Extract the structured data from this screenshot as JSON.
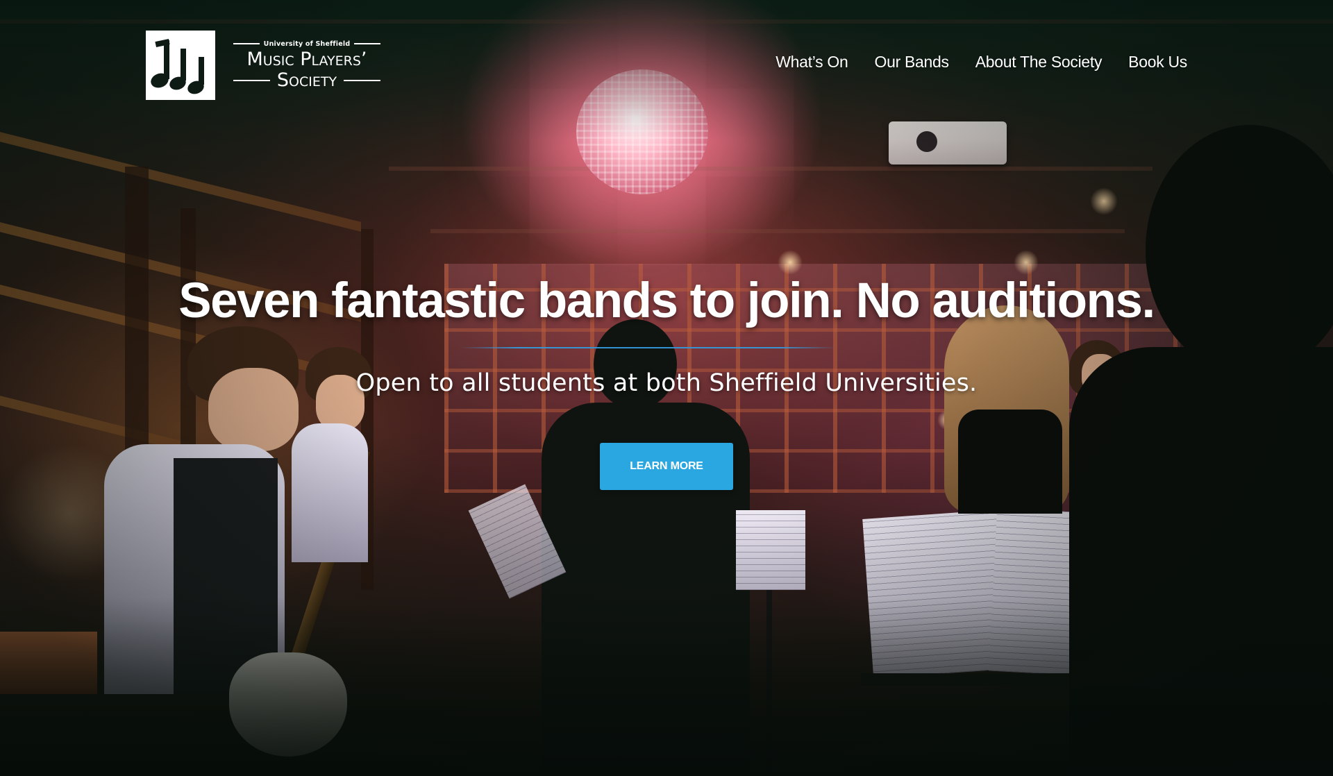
{
  "header": {
    "logo": {
      "top_line": "University of Sheffield",
      "main_line": "Music Players’",
      "bottom_line": "Society"
    },
    "nav": [
      {
        "label": "What’s On"
      },
      {
        "label": "Our Bands"
      },
      {
        "label": "About The Society"
      },
      {
        "label": "Book Us"
      }
    ]
  },
  "hero": {
    "title": "Seven fantastic bands to join. No auditions.",
    "subtitle": "Open to all students at both Sheffield Universities.",
    "cta_label": "LEARN MORE",
    "image_alt": "Band performing in a dimly lit venue",
    "accent_color": "#2aa6e0",
    "divider_color": "#3498db"
  }
}
